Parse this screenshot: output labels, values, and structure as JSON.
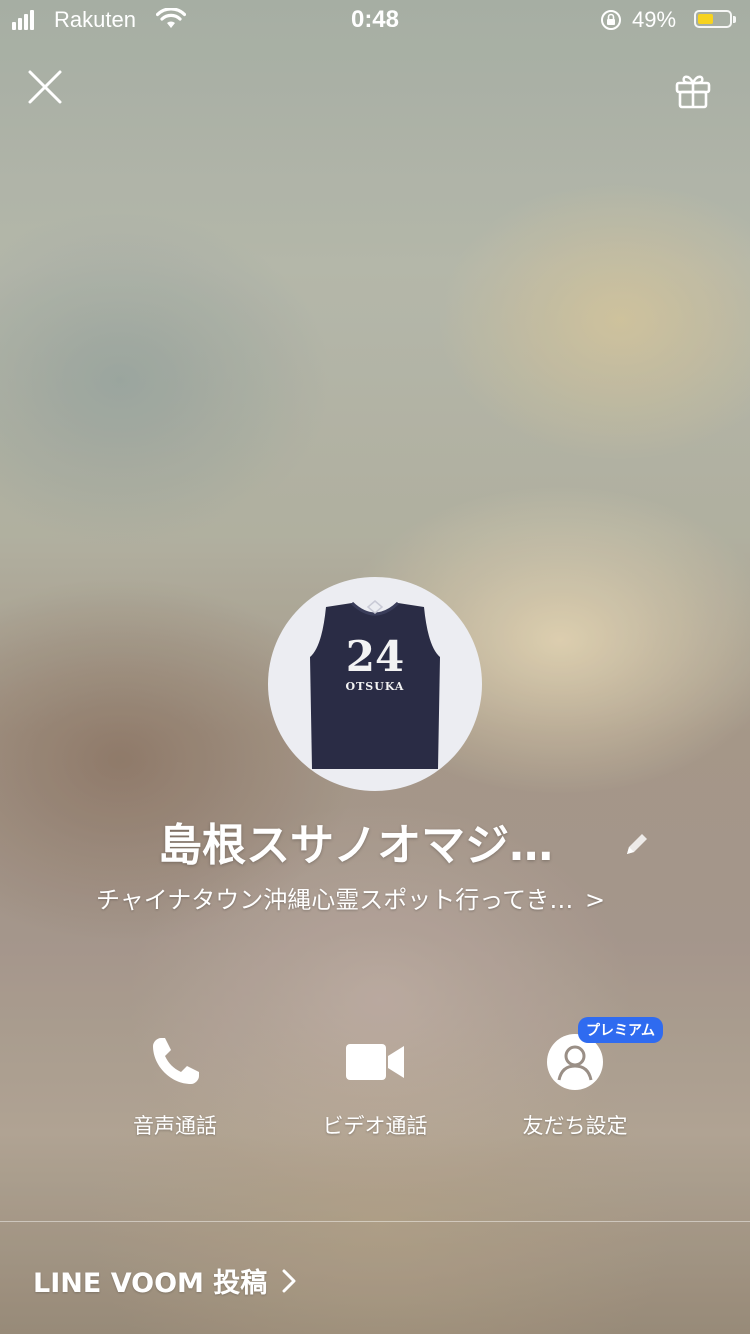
{
  "status_bar": {
    "carrier": "Rakuten",
    "time": "0:48",
    "battery_percent": "49%",
    "battery_level": 0.49,
    "battery_color": "#f7d31e"
  },
  "profile": {
    "name": "島根スサノオマジ…",
    "status_message": "チャイナタウン沖縄心霊スポット行ってき…",
    "jersey_number": "24",
    "jersey_name": "OTSUKA"
  },
  "actions": [
    {
      "label": "音声通話",
      "icon": "phone-icon"
    },
    {
      "label": "ビデオ通話",
      "icon": "video-camera-icon"
    },
    {
      "label": "友だち設定",
      "icon": "person-icon",
      "badge": "プレミアム"
    }
  ],
  "footer": {
    "voom_label": "LINE VOOM 投稿"
  },
  "colors": {
    "badge": "#2f6bf0"
  }
}
